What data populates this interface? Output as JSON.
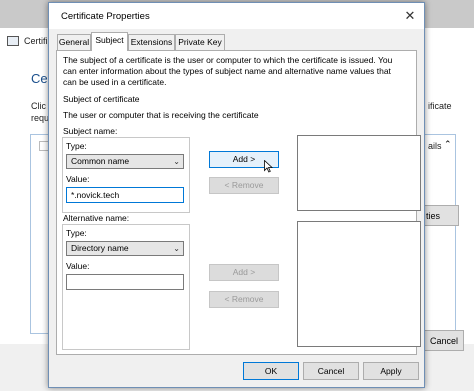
{
  "background": {
    "title_partial": "Certifi",
    "heading_partial": "Ce",
    "line1_partial": "Clic",
    "line2_partial": "requ",
    "right_text_partial": "ificate",
    "details_partial": "ails",
    "properties_partial": "ties",
    "cancel_label": "Cancel"
  },
  "dialog": {
    "title": "Certificate Properties",
    "close_glyph": "✕",
    "tabs": [
      {
        "label": "General",
        "active": false
      },
      {
        "label": "Subject",
        "active": true
      },
      {
        "label": "Extensions",
        "active": false
      },
      {
        "label": "Private Key",
        "active": false
      }
    ],
    "intro_text": [
      "The subject of a certificate is the user or computer to which the certificate is issued. You",
      "can enter information about the types of subject name and alternative name values that",
      "can be used in a certificate."
    ],
    "subject_heading": "Subject of certificate",
    "subject_desc": "The user or computer that is receiving the certificate",
    "subject_name": {
      "group_label": "Subject name:",
      "type_label": "Type:",
      "type_value": "Common name",
      "value_label": "Value:",
      "value_text": "*.novick.tech",
      "add_button": "Add >",
      "remove_button": "< Remove"
    },
    "alternative_name": {
      "group_label": "Alternative name:",
      "type_label": "Type:",
      "type_value": "Directory name",
      "value_label": "Value:",
      "value_text": "",
      "add_button": "Add >",
      "remove_button": "< Remove"
    },
    "footer": {
      "ok_label": "OK",
      "cancel_label": "Cancel",
      "apply_label": "Apply"
    }
  },
  "colors": {
    "accent": "#0078d7",
    "dialog_bg": "#f0f0f0",
    "heading_blue": "#1a4f8c"
  },
  "icons": {
    "close": "close-icon",
    "dropdown": "chevron-down-icon",
    "cursor": "mouse-pointer-icon",
    "app": "certificate-app-icon"
  }
}
